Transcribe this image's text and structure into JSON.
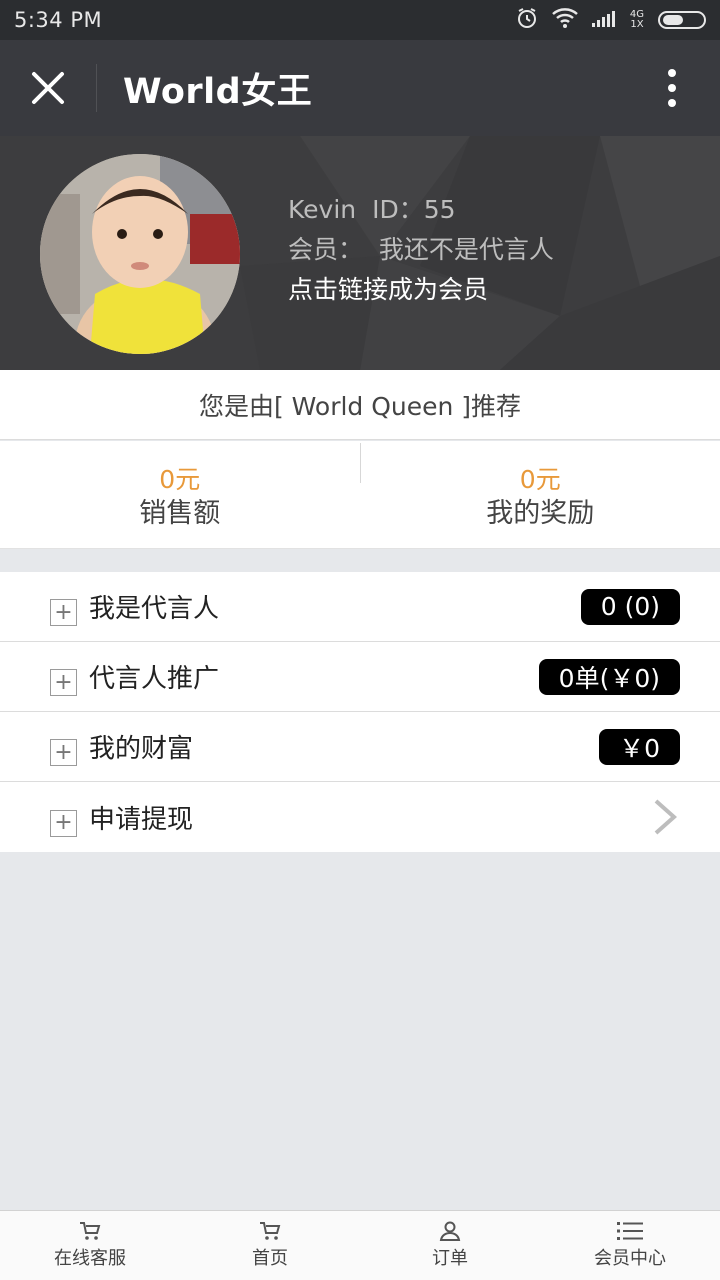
{
  "status_bar": {
    "time": "5:34 PM",
    "network_top": "4G",
    "network_bottom": "1X"
  },
  "nav": {
    "title": "World女王"
  },
  "profile": {
    "name": "Kevin",
    "id_label": "ID：55",
    "member_status": "会员：  我还不是代言人",
    "member_link": "点击链接成为会员"
  },
  "referral": {
    "text": "您是由[ World Queen ]推荐"
  },
  "stats": [
    {
      "value": "0元",
      "label": "销售额"
    },
    {
      "value": "0元",
      "label": "我的奖励"
    }
  ],
  "menu": [
    {
      "label": "我是代言人",
      "badge": "0 (0)"
    },
    {
      "label": "代言人推广",
      "badge": "0单(￥0)"
    },
    {
      "label": "我的财富",
      "badge": "￥0"
    },
    {
      "label": "申请提现"
    }
  ],
  "tabs": [
    {
      "label": "在线客服",
      "icon": "cart-icon"
    },
    {
      "label": "首页",
      "icon": "cart-icon"
    },
    {
      "label": "订单",
      "icon": "user-icon"
    },
    {
      "label": "会员中心",
      "icon": "list-icon"
    }
  ]
}
